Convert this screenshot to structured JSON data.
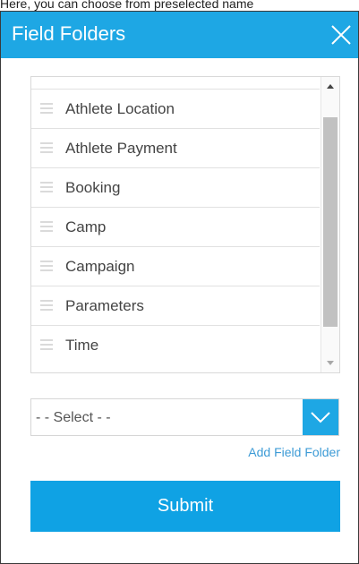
{
  "caption": "Here, you can choose from preselected name",
  "dialog": {
    "title": "Field Folders",
    "close_icon": "close-icon"
  },
  "folders": {
    "items": [
      {
        "label": ""
      },
      {
        "label": "Athlete Location"
      },
      {
        "label": "Athlete Payment"
      },
      {
        "label": "Booking"
      },
      {
        "label": "Camp"
      },
      {
        "label": "Campaign"
      },
      {
        "label": "Parameters"
      },
      {
        "label": "Time"
      }
    ],
    "scroll_position": 0.45
  },
  "select": {
    "value": "- - Select - -",
    "icon": "chevron-down-icon"
  },
  "add_link": "Add Field Folder",
  "submit_label": "Submit",
  "colors": {
    "accent": "#1ea7e4",
    "link": "#3d9bd6",
    "text": "#444444"
  }
}
